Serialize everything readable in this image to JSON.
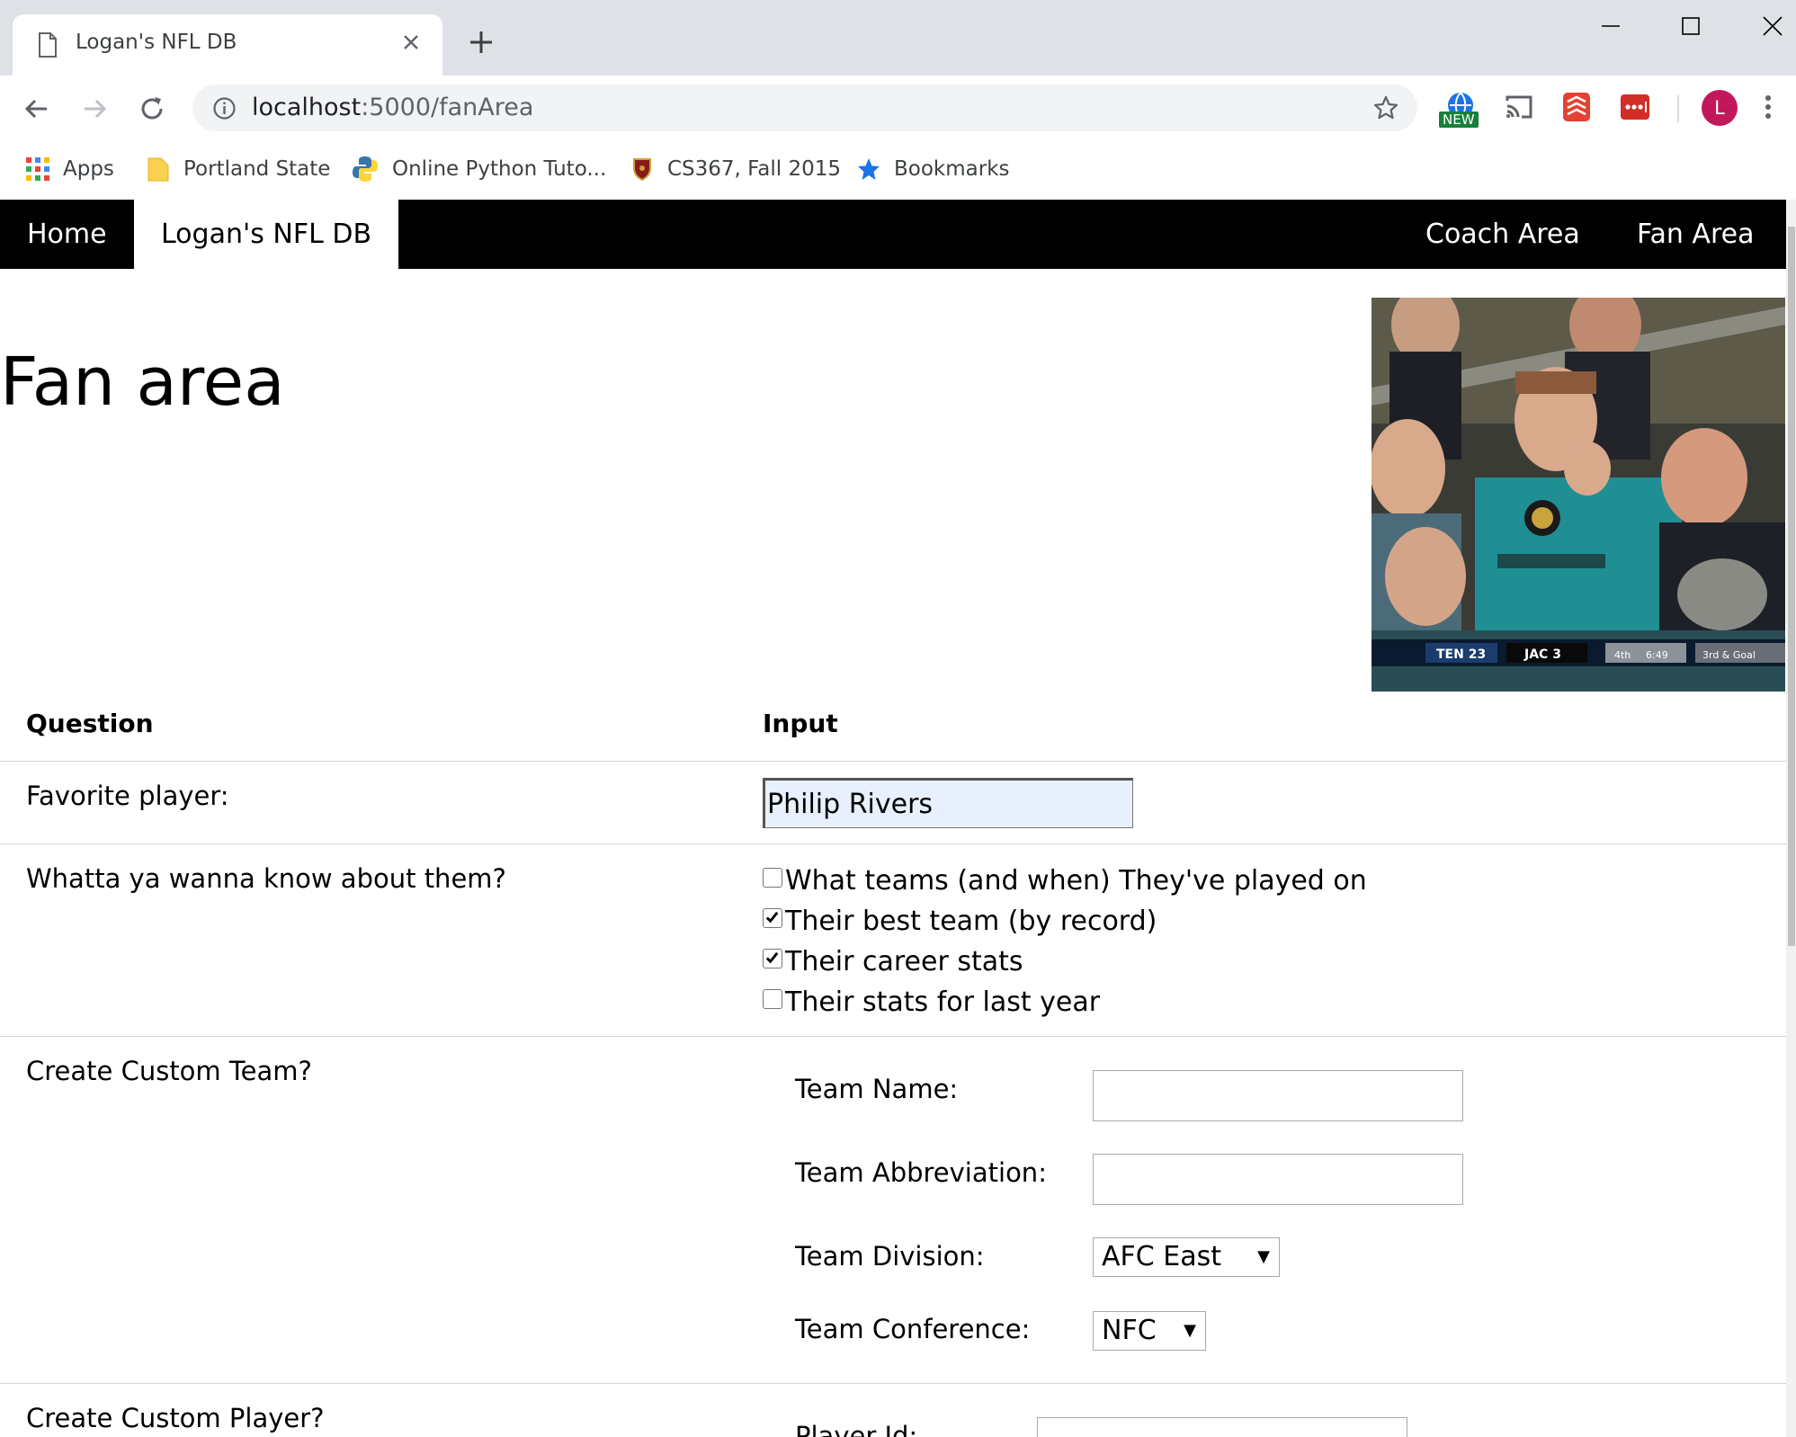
{
  "browser": {
    "tab_title": "Logan's NFL DB",
    "url_host": "localhost",
    "url_path": ":5000/fanArea",
    "extension_badge": "NEW",
    "profile_initial": "L",
    "bookmarks": [
      "Apps",
      "Portland State",
      "Online Python Tuto...",
      "CS367, Fall 2015",
      "Bookmarks"
    ]
  },
  "nav": {
    "home": "Home",
    "brand": "Logan's NFL DB",
    "coach_area": "Coach Area",
    "fan_area": "Fan Area"
  },
  "page": {
    "title": "Fan area",
    "hero_scoreboard": [
      "TEN 23",
      "JAC 3",
      "4th",
      "6:49",
      "3rd & Goal"
    ]
  },
  "form": {
    "header_question": "Question",
    "header_input": "Input",
    "favorite_label": "Favorite player:",
    "favorite_value": "Philip Rivers",
    "know_label": "Whatta ya wanna know about them?",
    "options": [
      {
        "label": "What teams (and when) They've played on",
        "checked": false
      },
      {
        "label": "Their best team (by record)",
        "checked": true
      },
      {
        "label": "Their career stats",
        "checked": true
      },
      {
        "label": "Their stats for last year",
        "checked": false
      }
    ],
    "custom_team_label": "Create Custom Team?",
    "team_name_label": "Team Name:",
    "team_name_value": "",
    "team_abbrev_label": "Team Abbreviation:",
    "team_abbrev_value": "",
    "team_division_label": "Team Division:",
    "team_division_value": "AFC East",
    "team_conference_label": "Team Conference:",
    "team_conference_value": "NFC",
    "custom_player_label": "Create Custom Player?",
    "player_id_label": "Player Id:"
  },
  "colors": {
    "navbar_bg": "#000000",
    "autofill_bg": "#e8f0fe",
    "avatar_bg": "#c2185b"
  }
}
